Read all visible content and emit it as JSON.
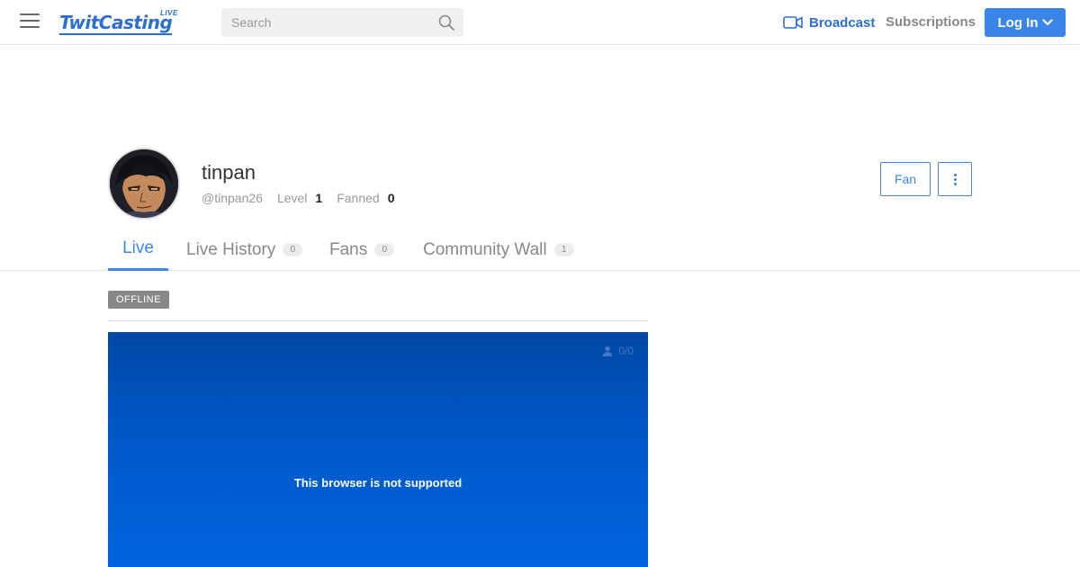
{
  "header": {
    "logo_text": "TwitCasting",
    "logo_sub": "LIVE",
    "search_placeholder": "Search",
    "broadcast_label": "Broadcast",
    "subscriptions_label": "Subscriptions",
    "login_label": "Log In",
    "accent_color": "#3a86e8"
  },
  "profile": {
    "name": "tinpan",
    "handle": "@tinpan26",
    "level_label": "Level",
    "level_value": "1",
    "fanned_label": "Fanned",
    "fanned_value": "0",
    "fan_button_label": "Fan"
  },
  "tabs": [
    {
      "label": "Live",
      "count": null,
      "active": true
    },
    {
      "label": "Live History",
      "count": "0",
      "active": false
    },
    {
      "label": "Fans",
      "count": "0",
      "active": false
    },
    {
      "label": "Community Wall",
      "count": "1",
      "active": false
    }
  ],
  "status": {
    "badge": "OFFLINE"
  },
  "player": {
    "viewer_count": "0/0",
    "message": "This browser is not supported"
  }
}
